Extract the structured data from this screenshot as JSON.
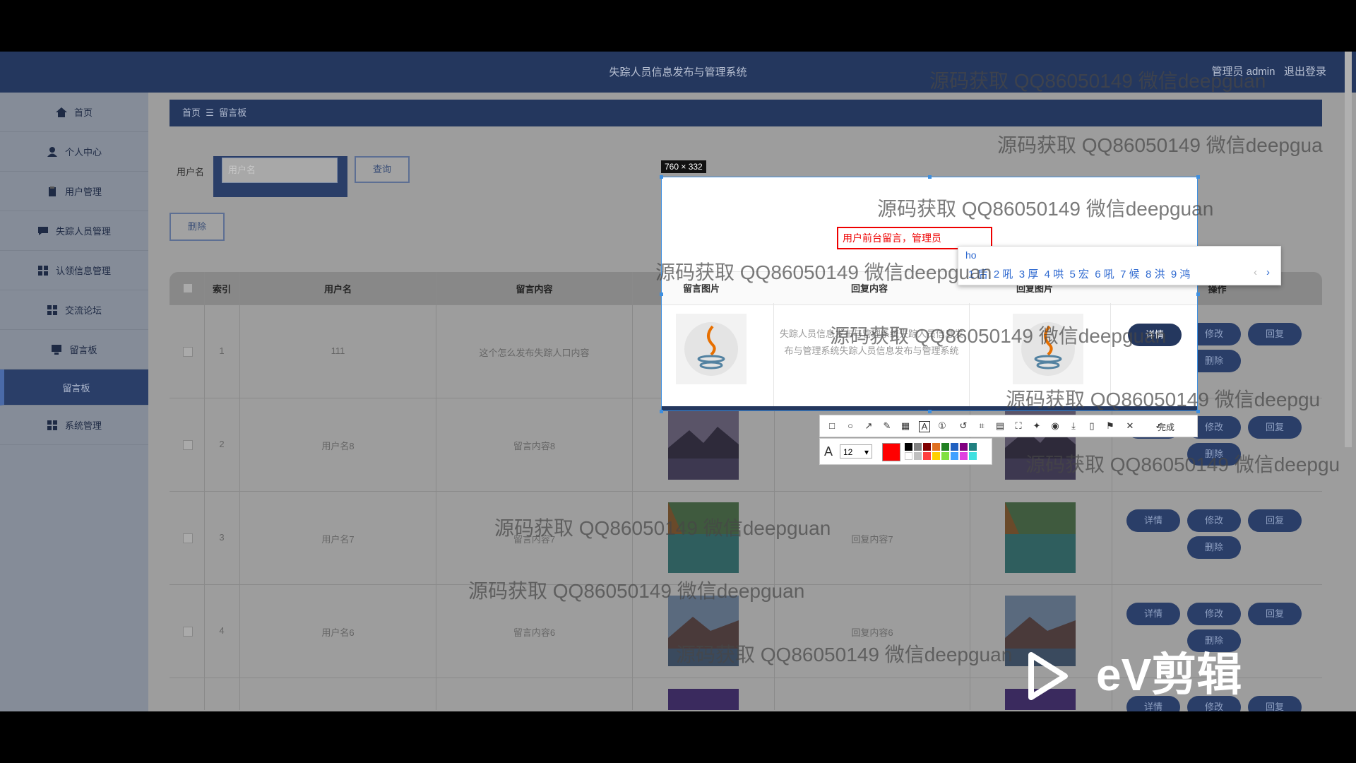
{
  "app": {
    "title": "失踪人员信息发布与管理系统",
    "user_label": "管理员 admin",
    "logout_label": "退出登录"
  },
  "sidebar": {
    "items": [
      {
        "label": "首页",
        "icon": "home-icon"
      },
      {
        "label": "个人中心",
        "icon": "person-icon"
      },
      {
        "label": "用户管理",
        "icon": "clipboard-icon"
      },
      {
        "label": "失踪人员管理",
        "icon": "chat-icon"
      },
      {
        "label": "认领信息管理",
        "icon": "grid-icon"
      },
      {
        "label": "交流论坛",
        "icon": "grid-icon"
      },
      {
        "label": "留言板",
        "icon": "monitor-icon"
      },
      {
        "label": "留言板",
        "icon": ""
      },
      {
        "label": "系统管理",
        "icon": "grid-icon"
      }
    ]
  },
  "breadcrumb": {
    "home": "首页",
    "sep": "☰",
    "current": "留言板"
  },
  "search": {
    "label": "用户名",
    "placeholder": "用户名",
    "button": "查询"
  },
  "actions": {
    "delete": "删除"
  },
  "table": {
    "columns": [
      "索引",
      "用户名",
      "留言内容",
      "留言图片",
      "回复内容",
      "回复图片",
      "操作"
    ],
    "rows": [
      {
        "index": "1",
        "username": "111",
        "content": "这个怎么发布失踪人口内容",
        "reply": "失踪人员信息发布与管理系统失踪人员信息发布与管理系统失踪人员信息发布与管理系统"
      },
      {
        "index": "2",
        "username": "用户名8",
        "content": "留言内容8",
        "reply": ""
      },
      {
        "index": "3",
        "username": "用户名7",
        "content": "留言内容7",
        "reply": "回复内容7"
      },
      {
        "index": "4",
        "username": "用户名6",
        "content": "留言内容6",
        "reply": "回复内容6"
      }
    ],
    "row_buttons": {
      "detail": "详情",
      "edit": "修改",
      "reply": "回复",
      "delete": "删除"
    }
  },
  "capture": {
    "size": "760 × 332",
    "annotation_text": "用户前台留言，管理员",
    "ime_input": "ho",
    "ime_candidates": [
      "1 后",
      "2 吼",
      "3 厚",
      "4 哄",
      "5 宏",
      "6 吼",
      "7 候",
      "8 洪",
      "9 鸿"
    ],
    "font_size": "12",
    "done_label": "完成",
    "palette": [
      "#ff0000",
      "#000000",
      "#808080",
      "#800000",
      "#808000",
      "#008000",
      "#008080",
      "#000080",
      "#800080",
      "#808040",
      "#ffffff",
      "#c0c0c0",
      "#ff0000",
      "#ffff00",
      "#00ff00",
      "#00ffff",
      "#0000ff",
      "#ff00ff",
      "#ffff80"
    ]
  },
  "watermark": "源码获取 QQ86050149 微信deepguan",
  "watermark_partial": "源码获取 QQ86050149 微信deepgu",
  "watermark_partial2": "源码获取 QQ86050149 微信deepgua",
  "video_logo": "eV剪辑"
}
